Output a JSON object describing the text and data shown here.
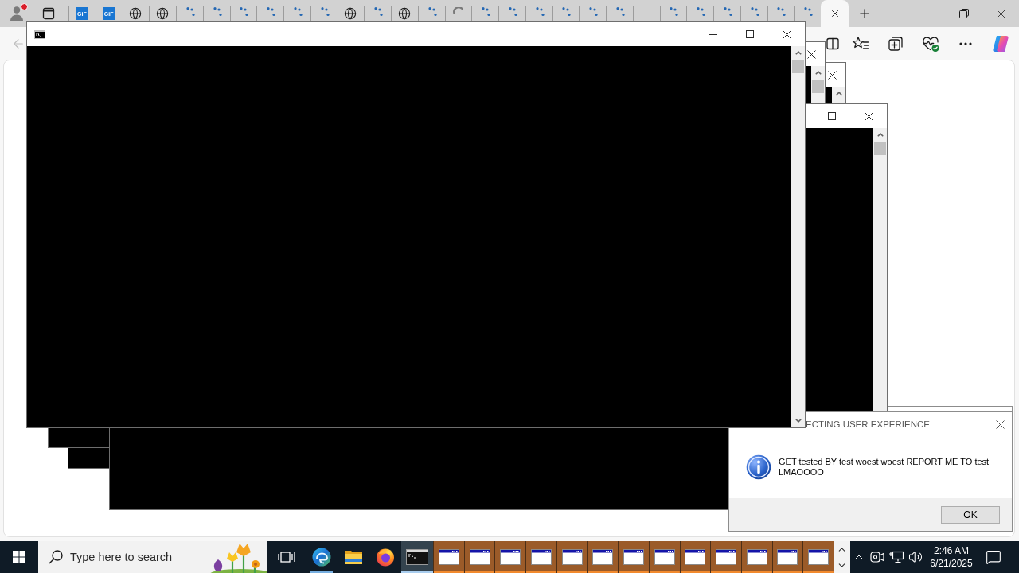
{
  "browser": {
    "profile": {
      "notification": true
    },
    "tabs": [
      {
        "kind": "gif",
        "favicon_text": "GiF",
        "selected": false
      },
      {
        "kind": "gif",
        "favicon_text": "GiF",
        "selected": false
      },
      {
        "kind": "globe",
        "selected": false
      },
      {
        "kind": "globe",
        "selected": false
      },
      {
        "kind": "loading",
        "selected": false
      },
      {
        "kind": "loading",
        "selected": false
      },
      {
        "kind": "loading",
        "selected": false
      },
      {
        "kind": "loading",
        "selected": false
      },
      {
        "kind": "loading",
        "selected": false
      },
      {
        "kind": "loading",
        "selected": false
      },
      {
        "kind": "globe",
        "selected": false
      },
      {
        "kind": "loading",
        "selected": false
      },
      {
        "kind": "globe",
        "selected": false
      },
      {
        "kind": "loading",
        "selected": false
      },
      {
        "kind": "waiting",
        "selected": false
      },
      {
        "kind": "loading",
        "selected": false
      },
      {
        "kind": "loading",
        "selected": false
      },
      {
        "kind": "loading",
        "selected": false
      },
      {
        "kind": "loading",
        "selected": false
      },
      {
        "kind": "loading",
        "selected": false
      },
      {
        "kind": "loading",
        "selected": false
      },
      {
        "kind": "blank",
        "selected": false
      },
      {
        "kind": "loading",
        "selected": false
      },
      {
        "kind": "loading",
        "selected": false
      },
      {
        "kind": "loading",
        "selected": false
      },
      {
        "kind": "loading",
        "selected": false
      },
      {
        "kind": "loading",
        "selected": false
      },
      {
        "kind": "loading",
        "selected": false
      },
      {
        "kind": "blank",
        "selected": true
      }
    ],
    "back_button": {
      "disabled": true
    }
  },
  "dialog": {
    "title": "ECTING USER EXPERIENCE",
    "message": "GET tested BY test woest woest REPORT ME TO test LMAOOOO",
    "buttons": [
      "OK"
    ]
  },
  "taskbar": {
    "search": {
      "placeholder": "Type here to search"
    },
    "apps": [
      {
        "kind": "edge",
        "running": true,
        "selected": false,
        "flashing": false
      },
      {
        "kind": "explorer",
        "running": false,
        "selected": false,
        "flashing": false
      },
      {
        "kind": "firefox",
        "running": false,
        "selected": false,
        "flashing": false
      },
      {
        "kind": "console",
        "running": true,
        "selected": true,
        "flashing": false
      },
      {
        "kind": "window",
        "running": true,
        "selected": false,
        "flashing": true
      },
      {
        "kind": "window",
        "running": true,
        "selected": false,
        "flashing": true
      },
      {
        "kind": "window",
        "running": true,
        "selected": false,
        "flashing": true
      },
      {
        "kind": "window",
        "running": true,
        "selected": false,
        "flashing": true
      },
      {
        "kind": "window",
        "running": true,
        "selected": false,
        "flashing": true
      },
      {
        "kind": "window",
        "running": true,
        "selected": false,
        "flashing": true
      },
      {
        "kind": "window",
        "running": true,
        "selected": false,
        "flashing": true
      },
      {
        "kind": "window",
        "running": true,
        "selected": false,
        "flashing": true
      },
      {
        "kind": "window",
        "running": true,
        "selected": false,
        "flashing": true
      },
      {
        "kind": "window",
        "running": true,
        "selected": false,
        "flashing": true
      },
      {
        "kind": "window",
        "running": true,
        "selected": false,
        "flashing": true
      },
      {
        "kind": "window",
        "running": true,
        "selected": false,
        "flashing": true
      },
      {
        "kind": "window",
        "running": true,
        "selected": false,
        "flashing": true
      }
    ],
    "clock": {
      "time": "2:46 AM",
      "date": "6/21/2025"
    }
  }
}
